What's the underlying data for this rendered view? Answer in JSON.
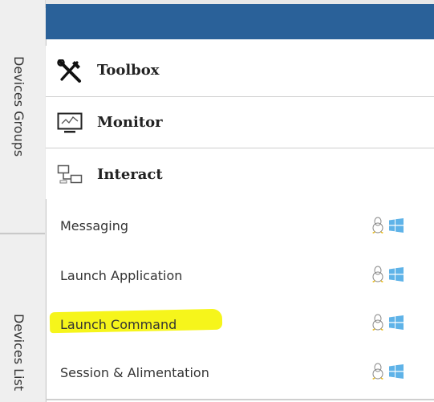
{
  "sidebar": {
    "tabs": [
      {
        "label": "Devices Groups"
      },
      {
        "label": "Devices List"
      }
    ]
  },
  "panel": {
    "sections": [
      {
        "label": "Toolbox",
        "icon": "tools-icon"
      },
      {
        "label": "Monitor",
        "icon": "monitor-icon"
      },
      {
        "label": "Interact",
        "icon": "interact-icon"
      }
    ],
    "interact_items": [
      {
        "label": "Messaging",
        "highlighted": false
      },
      {
        "label": "Launch Application",
        "highlighted": false
      },
      {
        "label": "Launch Command",
        "highlighted": true
      },
      {
        "label": "Session & Alimentation",
        "highlighted": false
      }
    ]
  },
  "colors": {
    "header": "#2a6199",
    "highlight": "#f6f51b",
    "windows_icon": "#5fb3e8"
  }
}
